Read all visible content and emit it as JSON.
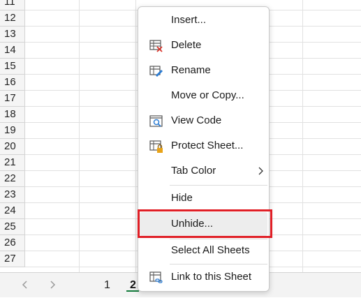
{
  "sheet": {
    "row_numbers": [
      "11",
      "12",
      "13",
      "14",
      "15",
      "16",
      "17",
      "18",
      "19",
      "20",
      "21",
      "22",
      "23",
      "24",
      "25",
      "26",
      "27"
    ]
  },
  "tabs": {
    "items": [
      {
        "label": "1",
        "active": false
      },
      {
        "label": "2",
        "active": true
      }
    ],
    "prev_icon": "chevron-left-icon",
    "next_icon": "chevron-right-icon"
  },
  "context_menu": {
    "items": [
      {
        "label": "Insert...",
        "icon": "none"
      },
      {
        "label": "Delete",
        "icon": "delete-sheet-icon"
      },
      {
        "label": "Rename",
        "icon": "rename-sheet-icon"
      },
      {
        "label": "Move or Copy...",
        "icon": "none"
      },
      {
        "label": "View Code",
        "icon": "view-code-icon"
      },
      {
        "label": "Protect Sheet...",
        "icon": "protect-sheet-icon"
      },
      {
        "label": "Tab Color",
        "icon": "none",
        "submenu": true
      },
      {
        "label": "Hide",
        "icon": "none"
      },
      {
        "label": "Unhide...",
        "icon": "none",
        "hovered": true
      },
      {
        "label": "Select All Sheets",
        "icon": "none"
      },
      {
        "label": "Link to this Sheet",
        "icon": "link-sheet-icon"
      }
    ]
  },
  "colors": {
    "highlight_border": "#e01f26",
    "active_tab_underline": "#117a3a",
    "hover_bg": "#ededed"
  }
}
